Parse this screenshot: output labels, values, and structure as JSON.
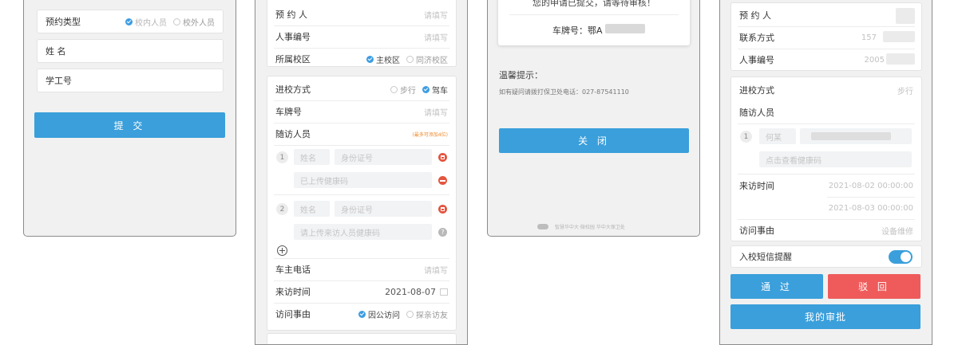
{
  "screen1": {
    "booking_type_label": "预约类型",
    "option_internal": "校内人员",
    "option_external": "校外人员",
    "name_placeholder": "姓 名",
    "id_placeholder": "学工号",
    "submit_label": "提 交"
  },
  "screen2": {
    "reserver_label": "预 约 人",
    "reserver_value": "请填写",
    "staff_no_label": "人事编号",
    "staff_no_value": "请填写",
    "campus_label": "所属校区",
    "campus_main": "主校区",
    "campus_tongji": "同济校区",
    "entry_label": "进校方式",
    "entry_walk": "步行",
    "entry_drive": "驾车",
    "plate_label": "车牌号",
    "plate_value": "请填写",
    "companion_label": "随访人员",
    "companion_note": "(最多可添加4位)",
    "visitor1_no": "1",
    "visitor1_name": "姓名",
    "visitor1_idcard": "身份证号",
    "visitor1_health": "已上传健康码",
    "visitor2_no": "2",
    "visitor2_name": "姓名",
    "visitor2_idcard": "身份证号",
    "visitor2_health": "请上传来访人员健康码",
    "owner_phone_label": "车主电话",
    "owner_phone_value": "请填写",
    "visit_time_label": "来访时间",
    "visit_time_value": "2021-08-07",
    "reason_label": "访问事由",
    "reason_official": "因公访问",
    "reason_family": "探亲访友"
  },
  "screen3": {
    "submitted_msg": "您的申请已提交，请等待审核！",
    "plate_label": "车牌号：鄂A",
    "tips_title": "温馨提示：",
    "tips_text": "如有疑问请拨打保卫处电话：027-87541110",
    "close_label": "关 闭",
    "footer_text": "智慧华中大·微校园 华中大保卫处"
  },
  "screen4": {
    "reserver_label": "预 约 人",
    "contact_label": "联系方式",
    "contact_value": "157",
    "staff_no_label": "人事编号",
    "staff_no_value": "2005",
    "entry_label": "进校方式",
    "entry_value": "步行",
    "companion_label": "随访人员",
    "visitor1_no": "1",
    "visitor1_name": "何某",
    "visitor1_health": "点击查看健康码",
    "visit_time_label": "来访时间",
    "visit_start": "2021-08-02 00:00:00",
    "visit_end": "2021-08-03 00:00:00",
    "reason_label": "访问事由",
    "reason_value": "设备维修",
    "sms_label": "入校短信提醒",
    "approve_label": "通 过",
    "reject_label": "驳 回",
    "my_approval_label": "我的审批"
  },
  "colors": {
    "accent": "#3a9fdb",
    "danger": "#ef5b5b",
    "icon_red": "#e4553f"
  }
}
